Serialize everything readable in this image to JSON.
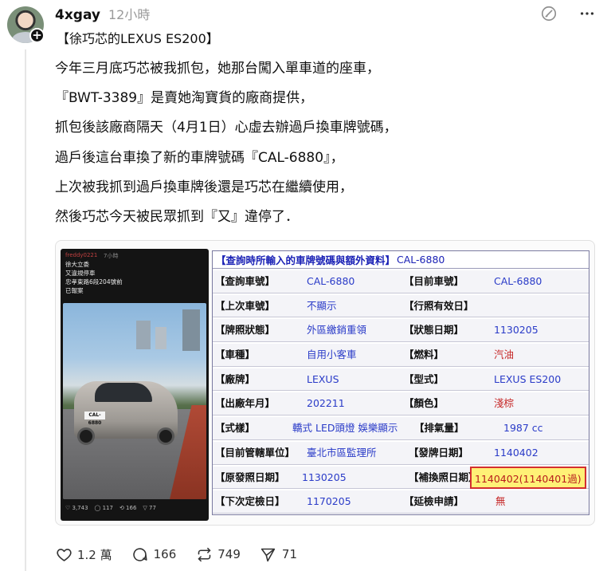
{
  "author": {
    "username": "4xgay",
    "time": "12小時"
  },
  "post": {
    "title": "【徐巧芯的LEXUS ES200】",
    "lines": [
      "今年三月底巧芯被我抓包，她那台闖入單車道的座車，",
      "『BWT-3389』是賣她淘寶貨的廠商提供，",
      "抓包後該廠商隔天（4月1日）心虛去辦過戶換車牌號碼，",
      "過戶後這台車換了新的車牌號碼『CAL-6880』，",
      "上次被我抓到過戶換車牌後還是巧芯在繼續使用，",
      "然後巧芯今天被民眾抓到『又』違停了．"
    ]
  },
  "embedded_post": {
    "user": "freddy0221",
    "time": "7小時",
    "lines": [
      "徐大立委",
      "又違規停車",
      "忠孝東路6段204號前",
      "已報案"
    ],
    "plate": "CAL-6880",
    "stats": [
      "♡ 3,743",
      "◯ 117",
      "⟲ 166",
      "▽ 77"
    ]
  },
  "record": {
    "title_label": "【查詢時所輸入的車牌號碼與額外資料】",
    "title_value": "CAL-6880",
    "rows": [
      {
        "l1": "【查詢車號】",
        "v1": "CAL-6880",
        "l2": "【目前車號】",
        "v2": "CAL-6880"
      },
      {
        "l1": "【上次車號】",
        "v1": "不顯示",
        "l2": "【行照有效日】",
        "v2": ""
      },
      {
        "l1": "【牌照狀態】",
        "v1": "外區繳銷重領",
        "l2": "【狀態日期】",
        "v2": "1130205"
      },
      {
        "l1": "【車種】",
        "v1": "自用小客車",
        "l2": "【燃料】",
        "v2": "汽油"
      },
      {
        "l1": "【廠牌】",
        "v1": "LEXUS",
        "l2": "【型式】",
        "v2": "LEXUS ES200"
      },
      {
        "l1": "【出廠年月】",
        "v1": "202211",
        "l2": "【顏色】",
        "v2": "淺棕"
      },
      {
        "l1": "【式樣】",
        "v1": "轎式 LED頭燈 娛樂顯示",
        "l2": "【排氣量】",
        "v2": "1987 cc"
      },
      {
        "l1": "【目前管轄單位】",
        "v1": "臺北市區監理所",
        "l2": "【發牌日期】",
        "v2": "1140402"
      },
      {
        "l1": "【原發照日期】",
        "v1": "1130205",
        "l2": "【補換照日期】",
        "v2": "1140402(1140401過)"
      },
      {
        "l1": "【下次定檢日】",
        "v1": "1170205",
        "l2": "【延檢申請】",
        "v2": "無"
      }
    ]
  },
  "actions": {
    "likes": "1.2 萬",
    "comments": "166",
    "reposts": "749",
    "shares": "71"
  },
  "colors": {
    "record_blue": "#1b22b6",
    "record_red": "#c62828",
    "highlight": "#fff176"
  }
}
